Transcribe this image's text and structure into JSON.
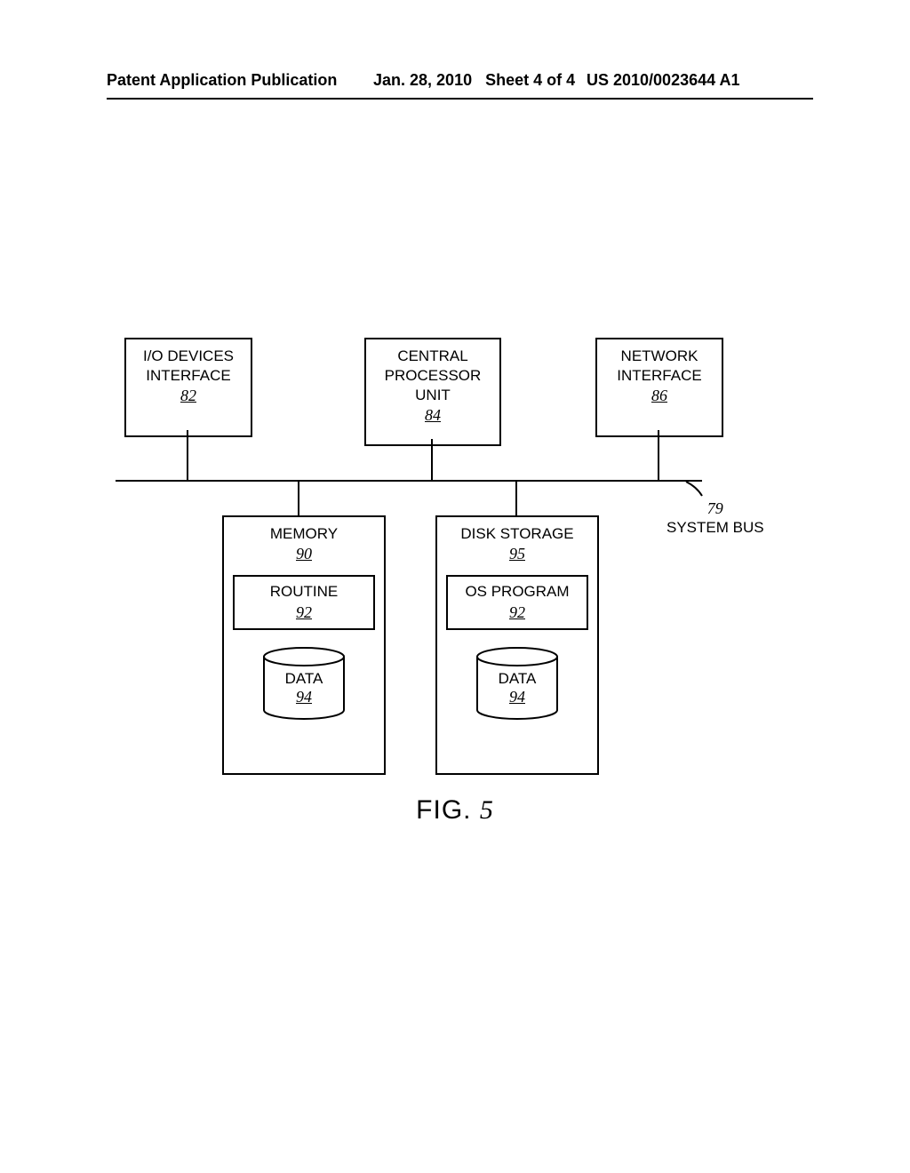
{
  "header": {
    "left": "Patent Application Publication",
    "mid_date": "Jan. 28, 2010",
    "mid_sheet": "Sheet 4 of 4",
    "right": "US 2010/0023644 A1"
  },
  "diagram": {
    "io": {
      "label1": "I/O DEVICES",
      "label2": "INTERFACE",
      "ref": "82"
    },
    "cpu": {
      "label1": "CENTRAL",
      "label2": "PROCESSOR",
      "label3": "UNIT",
      "ref": "84"
    },
    "net": {
      "label1": "NETWORK",
      "label2": "INTERFACE",
      "ref": "86"
    },
    "bus": {
      "ref": "79",
      "label": "SYSTEM BUS"
    },
    "memory": {
      "title": "MEMORY",
      "ref": "90",
      "routine": {
        "label": "ROUTINE",
        "ref": "92"
      },
      "data": {
        "label": "DATA",
        "ref": "94"
      }
    },
    "disk": {
      "title": "DISK STORAGE",
      "ref": "95",
      "program": {
        "label": "OS PROGRAM",
        "ref": "92"
      },
      "data": {
        "label": "DATA",
        "ref": "94"
      }
    }
  },
  "figure": {
    "label": "FIG.",
    "num": "5"
  }
}
